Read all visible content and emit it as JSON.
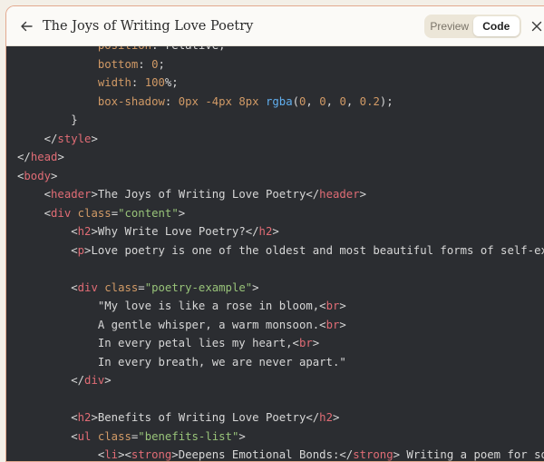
{
  "header": {
    "title": "The Joys of Writing Love Poetry",
    "toggle": {
      "preview_label": "Preview",
      "code_label": "Code",
      "active": "Code"
    },
    "icons": {
      "back": "arrow-left-icon",
      "close": "close-icon"
    }
  },
  "code": {
    "lines": [
      [
        {
          "t": "            ",
          "c": "text"
        },
        {
          "t": "position",
          "c": "attr"
        },
        {
          "t": ": relative;",
          "c": "text"
        }
      ],
      [
        {
          "t": "            ",
          "c": "text"
        },
        {
          "t": "bottom",
          "c": "attr"
        },
        {
          "t": ": ",
          "c": "text"
        },
        {
          "t": "0",
          "c": "num"
        },
        {
          "t": ";",
          "c": "text"
        }
      ],
      [
        {
          "t": "            ",
          "c": "text"
        },
        {
          "t": "width",
          "c": "attr"
        },
        {
          "t": ": ",
          "c": "text"
        },
        {
          "t": "100",
          "c": "num"
        },
        {
          "t": "%;",
          "c": "text"
        }
      ],
      [
        {
          "t": "            ",
          "c": "text"
        },
        {
          "t": "box-shadow",
          "c": "attr"
        },
        {
          "t": ": ",
          "c": "text"
        },
        {
          "t": "0px",
          "c": "num"
        },
        {
          "t": " ",
          "c": "text"
        },
        {
          "t": "-4px",
          "c": "num"
        },
        {
          "t": " ",
          "c": "text"
        },
        {
          "t": "8px",
          "c": "num"
        },
        {
          "t": " ",
          "c": "text"
        },
        {
          "t": "rgba",
          "c": "fn"
        },
        {
          "t": "(",
          "c": "text"
        },
        {
          "t": "0",
          "c": "num"
        },
        {
          "t": ", ",
          "c": "text"
        },
        {
          "t": "0",
          "c": "num"
        },
        {
          "t": ", ",
          "c": "text"
        },
        {
          "t": "0",
          "c": "num"
        },
        {
          "t": ", ",
          "c": "text"
        },
        {
          "t": "0.2",
          "c": "num"
        },
        {
          "t": ");",
          "c": "text"
        }
      ],
      [
        {
          "t": "        }",
          "c": "text"
        }
      ],
      [
        {
          "t": "    </",
          "c": "text"
        },
        {
          "t": "style",
          "c": "tag"
        },
        {
          "t": ">",
          "c": "text"
        }
      ],
      [
        {
          "t": "</",
          "c": "text"
        },
        {
          "t": "head",
          "c": "tag"
        },
        {
          "t": ">",
          "c": "text"
        }
      ],
      [
        {
          "t": "<",
          "c": "text"
        },
        {
          "t": "body",
          "c": "tag"
        },
        {
          "t": ">",
          "c": "text"
        }
      ],
      [
        {
          "t": "    <",
          "c": "text"
        },
        {
          "t": "header",
          "c": "tag"
        },
        {
          "t": ">The Joys of Writing Love Poetry</",
          "c": "text"
        },
        {
          "t": "header",
          "c": "tag"
        },
        {
          "t": ">",
          "c": "text"
        }
      ],
      [
        {
          "t": "    <",
          "c": "text"
        },
        {
          "t": "div",
          "c": "tag"
        },
        {
          "t": " ",
          "c": "text"
        },
        {
          "t": "class",
          "c": "attr"
        },
        {
          "t": "=",
          "c": "text"
        },
        {
          "t": "\"content\"",
          "c": "str"
        },
        {
          "t": ">",
          "c": "text"
        }
      ],
      [
        {
          "t": "        <",
          "c": "text"
        },
        {
          "t": "h2",
          "c": "tag"
        },
        {
          "t": ">Why Write Love Poetry?</",
          "c": "text"
        },
        {
          "t": "h2",
          "c": "tag"
        },
        {
          "t": ">",
          "c": "text"
        }
      ],
      [
        {
          "t": "        <",
          "c": "text"
        },
        {
          "t": "p",
          "c": "tag"
        },
        {
          "t": ">Love poetry is one of the oldest and most beautiful forms of self-expre",
          "c": "text"
        }
      ],
      [
        {
          "t": "",
          "c": "text"
        }
      ],
      [
        {
          "t": "        <",
          "c": "text"
        },
        {
          "t": "div",
          "c": "tag"
        },
        {
          "t": " ",
          "c": "text"
        },
        {
          "t": "class",
          "c": "attr"
        },
        {
          "t": "=",
          "c": "text"
        },
        {
          "t": "\"poetry-example\"",
          "c": "str"
        },
        {
          "t": ">",
          "c": "text"
        }
      ],
      [
        {
          "t": "            \"My love is like a rose in bloom,<",
          "c": "text"
        },
        {
          "t": "br",
          "c": "tag"
        },
        {
          "t": ">",
          "c": "text"
        }
      ],
      [
        {
          "t": "            A gentle whisper, a warm monsoon.<",
          "c": "text"
        },
        {
          "t": "br",
          "c": "tag"
        },
        {
          "t": ">",
          "c": "text"
        }
      ],
      [
        {
          "t": "            In every petal lies my heart,<",
          "c": "text"
        },
        {
          "t": "br",
          "c": "tag"
        },
        {
          "t": ">",
          "c": "text"
        }
      ],
      [
        {
          "t": "            In every breath, we are never apart.\"",
          "c": "text"
        }
      ],
      [
        {
          "t": "        </",
          "c": "text"
        },
        {
          "t": "div",
          "c": "tag"
        },
        {
          "t": ">",
          "c": "text"
        }
      ],
      [
        {
          "t": "",
          "c": "text"
        }
      ],
      [
        {
          "t": "        <",
          "c": "text"
        },
        {
          "t": "h2",
          "c": "tag"
        },
        {
          "t": ">Benefits of Writing Love Poetry</",
          "c": "text"
        },
        {
          "t": "h2",
          "c": "tag"
        },
        {
          "t": ">",
          "c": "text"
        }
      ],
      [
        {
          "t": "        <",
          "c": "text"
        },
        {
          "t": "ul",
          "c": "tag"
        },
        {
          "t": " ",
          "c": "text"
        },
        {
          "t": "class",
          "c": "attr"
        },
        {
          "t": "=",
          "c": "text"
        },
        {
          "t": "\"benefits-list\"",
          "c": "str"
        },
        {
          "t": ">",
          "c": "text"
        }
      ],
      [
        {
          "t": "            <",
          "c": "text"
        },
        {
          "t": "li",
          "c": "tag"
        },
        {
          "t": "><",
          "c": "text"
        },
        {
          "t": "strong",
          "c": "tag"
        },
        {
          "t": ">Deepens Emotional Bonds:</",
          "c": "text"
        },
        {
          "t": "strong",
          "c": "tag"
        },
        {
          "t": "> Writing a poem for some",
          "c": "text"
        }
      ]
    ]
  }
}
